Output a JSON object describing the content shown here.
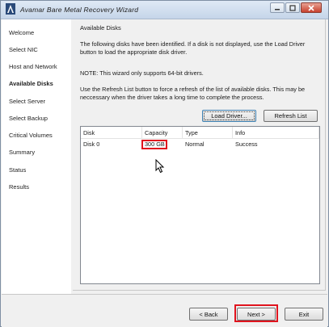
{
  "window": {
    "title": "Avamar Bare Metal Recovery Wizard",
    "icon": "avamar-logo-icon",
    "controls": [
      "minimize-icon",
      "maximize-icon",
      "close-icon"
    ]
  },
  "sidebar": {
    "items": [
      {
        "label": "Welcome",
        "active": false
      },
      {
        "label": "Select NIC",
        "active": false
      },
      {
        "label": "Host and Network",
        "active": false
      },
      {
        "label": "Available Disks",
        "active": true
      },
      {
        "label": "Select Server",
        "active": false
      },
      {
        "label": "Select Backup",
        "active": false
      },
      {
        "label": "Critical Volumes",
        "active": false
      },
      {
        "label": "Summary",
        "active": false
      },
      {
        "label": "Status",
        "active": false
      },
      {
        "label": "Results",
        "active": false
      }
    ]
  },
  "main": {
    "title": "Available Disks",
    "paragraph1": "The following disks have been identified. If a disk is not displayed, use the Load Driver button to load the appropriate disk driver.",
    "note": "NOTE: This wizard only supports 64-bit drivers.",
    "paragraph2": "Use the Refresh List button to force a refresh of the list of available disks. This may be neccessary when the driver takes a long time to complete the process.",
    "load_driver_label": "Load Driver...",
    "refresh_list_label": "Refresh List",
    "table": {
      "columns": [
        "Disk",
        "Capacity",
        "Type",
        "Info"
      ],
      "rows": [
        [
          "Disk 0",
          "300 GB",
          "Normal",
          "Success"
        ]
      ]
    }
  },
  "footer": {
    "back_label": "< Back",
    "next_label": "Next >",
    "exit_label": "Exit"
  },
  "colors": {
    "highlight": "#e0141e",
    "titlebar": "#c5d5e9",
    "sidebar_bg": "#ffffff"
  }
}
